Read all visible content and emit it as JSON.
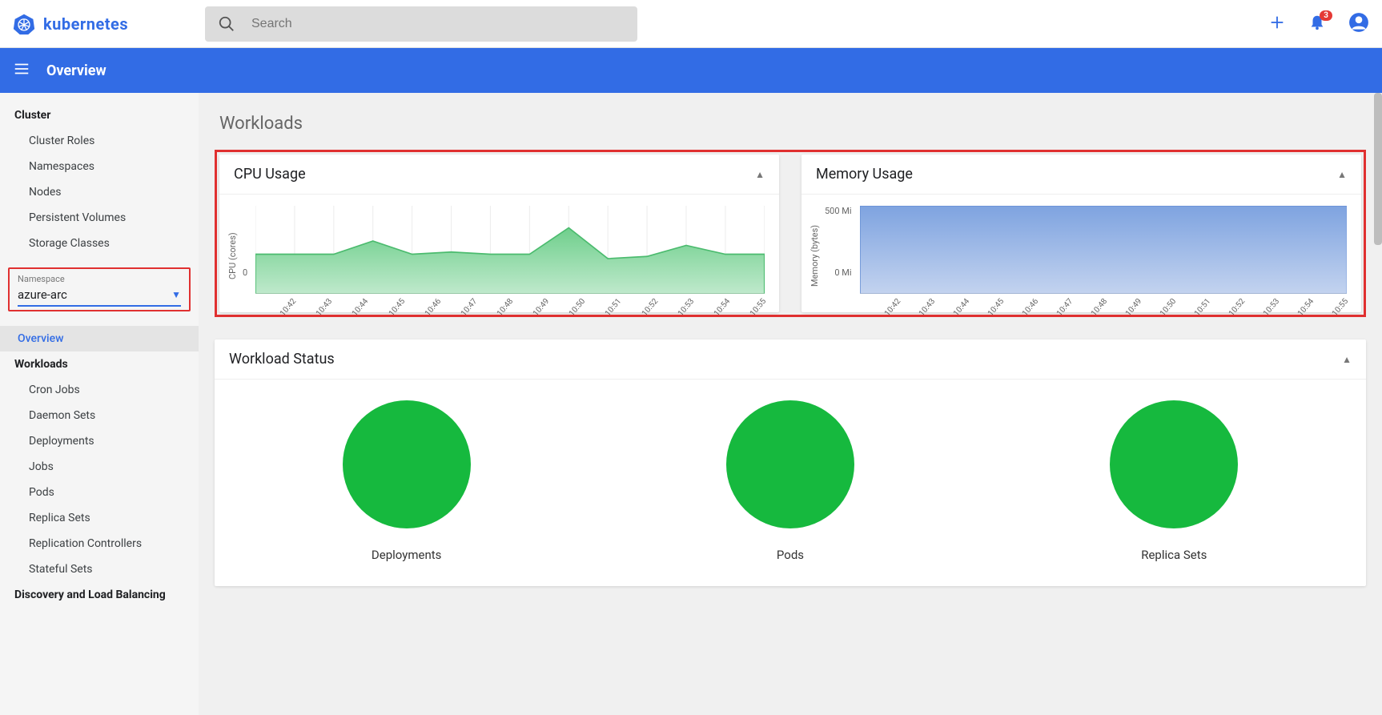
{
  "brand": {
    "name": "kubernetes"
  },
  "search": {
    "placeholder": "Search"
  },
  "notifications": {
    "count": "3"
  },
  "bluebar": {
    "title": "Overview"
  },
  "sidebar": {
    "cluster_heading": "Cluster",
    "cluster_items": [
      "Cluster Roles",
      "Namespaces",
      "Nodes",
      "Persistent Volumes",
      "Storage Classes"
    ],
    "namespace_label": "Namespace",
    "namespace_value": "azure-arc",
    "overview": "Overview",
    "workloads_heading": "Workloads",
    "workloads_items": [
      "Cron Jobs",
      "Daemon Sets",
      "Deployments",
      "Jobs",
      "Pods",
      "Replica Sets",
      "Replication Controllers",
      "Stateful Sets"
    ],
    "discovery_heading": "Discovery and Load Balancing"
  },
  "page": {
    "title": "Workloads"
  },
  "cpu": {
    "title": "CPU Usage",
    "ylabel": "CPU (cores)",
    "ymin_label": "0"
  },
  "mem": {
    "title": "Memory Usage",
    "ylabel": "Memory (bytes)",
    "ymax_label": "500 Mi",
    "ymin_label": "0 Mi"
  },
  "status": {
    "title": "Workload Status",
    "items": [
      "Deployments",
      "Pods",
      "Replica Sets"
    ]
  },
  "chart_data": [
    {
      "type": "area",
      "title": "CPU Usage",
      "ylabel": "CPU (cores)",
      "xlabel": "",
      "ylim": [
        0,
        0.2
      ],
      "categories": [
        "10:42",
        "10:43",
        "10:44",
        "10:45",
        "10:46",
        "10:47",
        "10:48",
        "10:49",
        "10:50",
        "10:51",
        "10:52",
        "10:53",
        "10:54",
        "10:55"
      ],
      "values": [
        0.09,
        0.09,
        0.09,
        0.12,
        0.09,
        0.095,
        0.09,
        0.09,
        0.15,
        0.08,
        0.085,
        0.11,
        0.09,
        0.09
      ]
    },
    {
      "type": "area",
      "title": "Memory Usage",
      "ylabel": "Memory (bytes)",
      "xlabel": "",
      "ylim": [
        0,
        500
      ],
      "y_unit": "Mi",
      "categories": [
        "10:42",
        "10:43",
        "10:44",
        "10:45",
        "10:46",
        "10:47",
        "10:48",
        "10:49",
        "10:50",
        "10:51",
        "10:52",
        "10:53",
        "10:54",
        "10:55"
      ],
      "values": [
        500,
        500,
        500,
        500,
        500,
        500,
        500,
        500,
        500,
        500,
        500,
        500,
        500,
        500
      ]
    }
  ]
}
